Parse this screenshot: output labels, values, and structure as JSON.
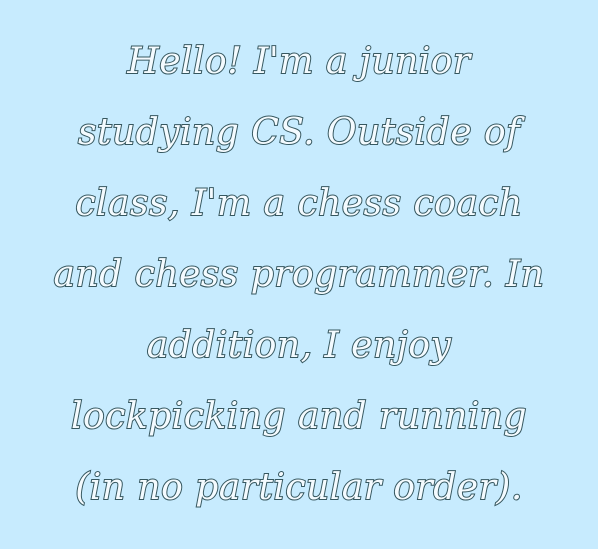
{
  "bio": {
    "lines": [
      "Hello! I'm a junior",
      "studying CS. Outside of",
      "class, I'm a chess coach",
      "and chess programmer. In",
      "addition, I enjoy",
      "lockpicking and running",
      "(in no particular order)."
    ]
  },
  "colors": {
    "background": "#c7ebfe",
    "text_fill": "#f4fbff",
    "text_outline": "#36575f"
  }
}
